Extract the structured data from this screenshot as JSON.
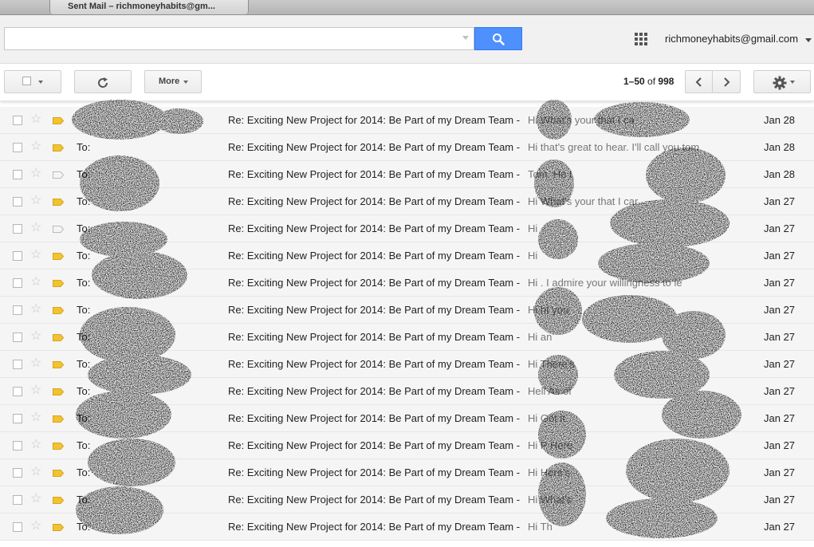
{
  "browser": {
    "tab_title": "Sent Mail – richmoneyhabits@gm..."
  },
  "header": {
    "search_value": "",
    "account_email": "richmoneyhabits@gmail.com"
  },
  "toolbar": {
    "more_label": "More",
    "pager_range": "1–50",
    "pager_of": " of ",
    "pager_total": "998"
  },
  "colors": {
    "search_blue": "#4d90fe",
    "important_marker": "#f2c231"
  },
  "mail": [
    {
      "sender": "",
      "subject": "Re: Exciting New Project for 2014: Be Part of my Dream Team - ",
      "snippet": "Hi What's your that I ca",
      "date": "Jan 28",
      "important": true
    },
    {
      "sender": "To:",
      "subject": "Re: Exciting New Project for 2014: Be Part of my Dream Team - ",
      "snippet": "Hi that's great to hear. I'll call you tom",
      "date": "Jan 28",
      "important": true
    },
    {
      "sender": "To:",
      "subject": "Re: Exciting New Project for 2014: Be Part of my Dream Team - ",
      "snippet": "Tom. He I",
      "date": "Jan 28",
      "important": false
    },
    {
      "sender": "To:",
      "subject": "Re: Exciting New Project for 2014: Be Part of my Dream Team - ",
      "snippet": "Hi What's your that I car",
      "date": "Jan 27",
      "important": true
    },
    {
      "sender": "To:",
      "subject": "Re: Exciting New Project for 2014: Be Part of my Dream Team - ",
      "snippet": "Hi",
      "date": "Jan 27",
      "important": false
    },
    {
      "sender": "To:",
      "subject": "Re: Exciting New Project for 2014: Be Part of my Dream Team - ",
      "snippet": "Hi",
      "date": "Jan 27",
      "important": true
    },
    {
      "sender": "To:",
      "subject": "Re: Exciting New Project for 2014: Be Part of my Dream Team - ",
      "snippet": "Hi . I admire your willingness to le",
      "date": "Jan 27",
      "important": true
    },
    {
      "sender": "To:",
      "subject": "Re: Exciting New Project for 2014: Be Part of my Dream Team - ",
      "snippet": "Hi ht you",
      "date": "Jan 27",
      "important": true
    },
    {
      "sender": "To:",
      "subject": "Re: Exciting New Project for 2014: Be Part of my Dream Team - ",
      "snippet": "Hi an",
      "date": "Jan 27",
      "important": true
    },
    {
      "sender": "To:",
      "subject": "Re: Exciting New Project for 2014: Be Part of my Dream Team - ",
      "snippet": "Hi There's",
      "date": "Jan 27",
      "important": true
    },
    {
      "sender": "To:",
      "subject": "Re: Exciting New Project for 2014: Be Part of my Dream Team - ",
      "snippet": "Hell As of",
      "date": "Jan 27",
      "important": true
    },
    {
      "sender": "To:",
      "subject": "Re: Exciting New Project for 2014: Be Part of my Dream Team - ",
      "snippet": "Hi Got it.",
      "date": "Jan 27",
      "important": true
    },
    {
      "sender": "To:",
      "subject": "Re: Exciting New Project for 2014: Be Part of my Dream Team - ",
      "snippet": "Hi P Here",
      "date": "Jan 27",
      "important": true
    },
    {
      "sender": "To:",
      "subject": "Re: Exciting New Project for 2014: Be Part of my Dream Team - ",
      "snippet": "Hi Here's",
      "date": "Jan 27",
      "important": true
    },
    {
      "sender": "To:",
      "subject": "Re: Exciting New Project for 2014: Be Part of my Dream Team - ",
      "snippet": "Hi What's",
      "date": "Jan 27",
      "important": true
    },
    {
      "sender": "To:",
      "subject": "Re: Exciting New Project for 2014: Be Part of my Dream Team - ",
      "snippet": "Hi Th",
      "date": "Jan 27",
      "important": true
    }
  ]
}
